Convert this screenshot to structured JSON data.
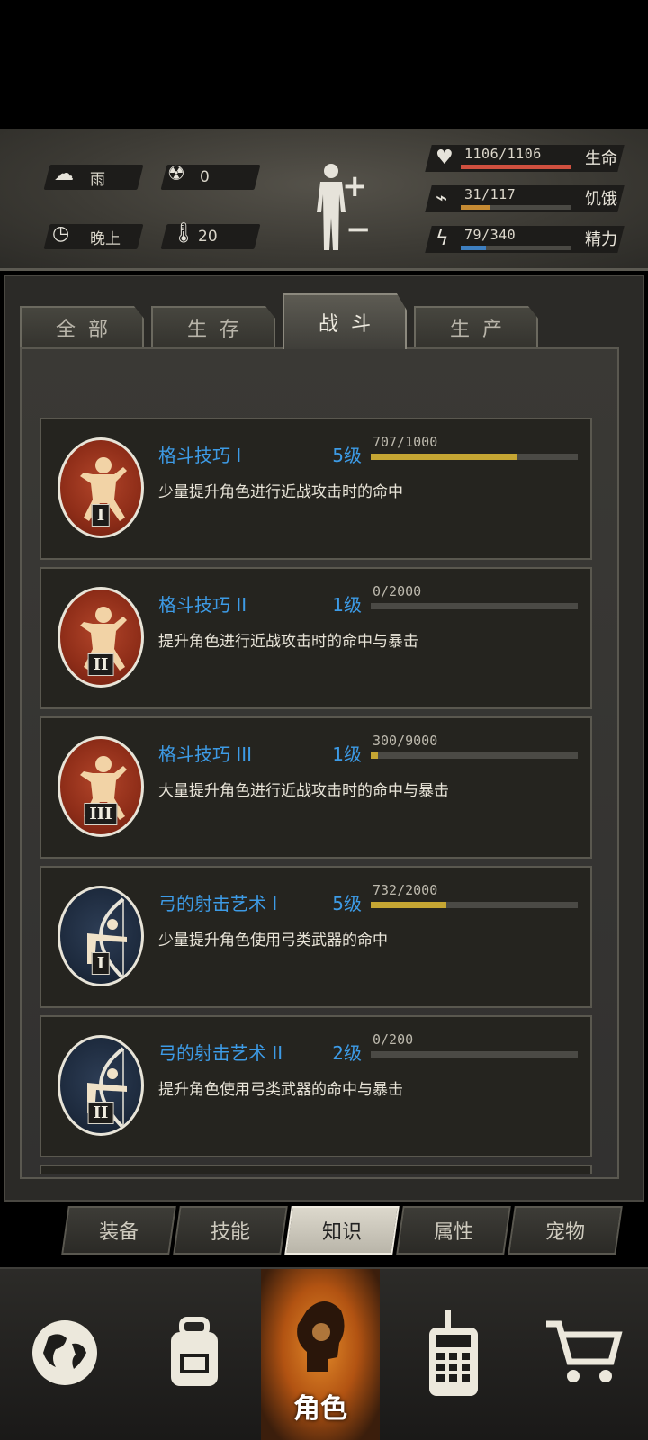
{
  "status": {
    "weather": {
      "icon": "rain-cloud-icon",
      "value": "雨"
    },
    "radiation": {
      "icon": "radiation-icon",
      "value": "0"
    },
    "time": {
      "icon": "clock-icon",
      "value": "晚上"
    },
    "temperature": {
      "icon": "thermometer-icon",
      "value": "20"
    },
    "body_icon": "body-figure-plus-minus-icon",
    "bars": [
      {
        "icon": "heart-pulse-icon",
        "text": "1106/1106",
        "label": "生命",
        "fraction": 1.0,
        "color": "#d0503f"
      },
      {
        "icon": "stomach-icon",
        "text": "31/117",
        "label": "饥饿",
        "fraction": 0.265,
        "color": "#c58a33"
      },
      {
        "icon": "head-lightning-icon",
        "text": "79/340",
        "label": "精力",
        "fraction": 0.232,
        "color": "#3e7fc0"
      }
    ]
  },
  "tabs": [
    {
      "label": "全部",
      "active": false
    },
    {
      "label": "生存",
      "active": false
    },
    {
      "label": "战斗",
      "active": true
    },
    {
      "label": "生产",
      "active": false
    }
  ],
  "skills": [
    {
      "name": "格斗技巧 I",
      "level": "5级",
      "xp": "707/1000",
      "fraction": 0.707,
      "desc": "少量提升角色进行近战攻击时的命中",
      "badge": "red",
      "roman": "I",
      "icon": "martial-arts-icon"
    },
    {
      "name": "格斗技巧 II",
      "level": "1级",
      "xp": "0/2000",
      "fraction": 0.0,
      "desc": "提升角色进行近战攻击时的命中与暴击",
      "badge": "red",
      "roman": "II",
      "icon": "martial-arts-icon"
    },
    {
      "name": "格斗技巧 III",
      "level": "1级",
      "xp": "300/9000",
      "fraction": 0.033,
      "desc": "大量提升角色进行近战攻击时的命中与暴击",
      "badge": "red",
      "roman": "III",
      "icon": "martial-arts-icon"
    },
    {
      "name": "弓的射击艺术 I",
      "level": "5级",
      "xp": "732/2000",
      "fraction": 0.366,
      "desc": "少量提升角色使用弓类武器的命中",
      "badge": "blue",
      "roman": "I",
      "icon": "archer-icon"
    },
    {
      "name": "弓的射击艺术 II",
      "level": "2级",
      "xp": "0/200",
      "fraction": 0.0,
      "desc": "提升角色使用弓类武器的命中与暴击",
      "badge": "blue",
      "roman": "II",
      "icon": "archer-icon"
    }
  ],
  "subnav": [
    {
      "label": "装备",
      "active": false
    },
    {
      "label": "技能",
      "active": false
    },
    {
      "label": "知识",
      "active": true
    },
    {
      "label": "属性",
      "active": false
    },
    {
      "label": "宠物",
      "active": false
    }
  ],
  "bottom_nav": [
    {
      "icon": "globe-icon",
      "label": ""
    },
    {
      "icon": "backpack-icon",
      "label": ""
    },
    {
      "icon": "character-head-icon",
      "label": "角色",
      "active": true
    },
    {
      "icon": "walkie-talkie-icon",
      "label": ""
    },
    {
      "icon": "shopping-cart-icon",
      "label": ""
    }
  ]
}
